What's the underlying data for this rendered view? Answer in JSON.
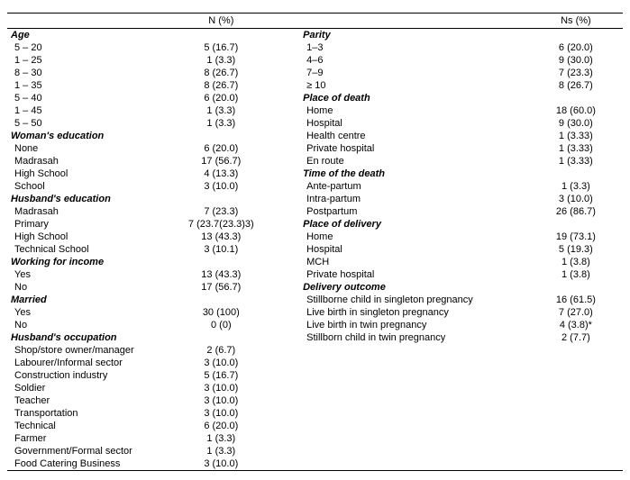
{
  "header": {
    "col1": "N (%)",
    "col2": "Ns (%)"
  },
  "left": [
    {
      "type": "section",
      "label": "Age"
    },
    {
      "type": "row",
      "label": "5 – 20",
      "value": "5 (16.7)"
    },
    {
      "type": "row",
      "label": "1 – 25",
      "value": "1 (3.3)"
    },
    {
      "type": "row",
      "label": "8 – 30",
      "value": "8 (26.7)"
    },
    {
      "type": "row",
      "label": "1 – 35",
      "value": "8 (26.7)"
    },
    {
      "type": "row",
      "label": "5 – 40",
      "value": "6 (20.0)"
    },
    {
      "type": "row",
      "label": "1 – 45",
      "value": "1 (3.3)"
    },
    {
      "type": "row",
      "label": "5 – 50",
      "value": "1 (3.3)"
    },
    {
      "type": "section",
      "label": "Woman's education"
    },
    {
      "type": "row",
      "label": "None",
      "value": "6 (20.0)"
    },
    {
      "type": "row",
      "label": "Madrasah",
      "value": "17 (56.7)"
    },
    {
      "type": "row",
      "label": "High School",
      "value": "4 (13.3)"
    },
    {
      "type": "row",
      "label": "School",
      "value": "3 (10.0)"
    },
    {
      "type": "section",
      "label": "Husband's education"
    },
    {
      "type": "row",
      "label": "Madrasah",
      "value": "7 (23.3)"
    },
    {
      "type": "row",
      "label": "Primary",
      "value": "7 (23.7(23.3)3)"
    },
    {
      "type": "row",
      "label": "High School",
      "value": "13 (43.3)"
    },
    {
      "type": "row",
      "label": "Technical School",
      "value": "3 (10.1)"
    },
    {
      "type": "section",
      "label": "Working for income"
    },
    {
      "type": "row",
      "label": "Yes",
      "value": "13 (43.3)"
    },
    {
      "type": "row",
      "label": "No",
      "value": "17 (56.7)"
    },
    {
      "type": "section",
      "label": "Married"
    },
    {
      "type": "row",
      "label": "Yes",
      "value": "30 (100)"
    },
    {
      "type": "row",
      "label": "No",
      "value": "0 (0)"
    },
    {
      "type": "section",
      "label": "Husband's occupation"
    },
    {
      "type": "row",
      "label": "Shop/store owner/manager",
      "value": "2 (6.7)"
    },
    {
      "type": "row",
      "label": "Labourer/Informal sector",
      "value": "3 (10.0)"
    },
    {
      "type": "row",
      "label": "Construction industry",
      "value": "5 (16.7)"
    },
    {
      "type": "row",
      "label": "Soldier",
      "value": "3 (10.0)"
    },
    {
      "type": "row",
      "label": "Teacher",
      "value": "3 (10.0)"
    },
    {
      "type": "row",
      "label": "Transportation",
      "value": "3 (10.0)"
    },
    {
      "type": "row",
      "label": "Technical",
      "value": "6 (20.0)"
    },
    {
      "type": "row",
      "label": "Farmer",
      "value": "1 (3.3)"
    },
    {
      "type": "row",
      "label": "Government/Formal sector",
      "value": "1 (3.3)"
    },
    {
      "type": "row",
      "label": "Food Catering Business",
      "value": "3 (10.0)"
    }
  ],
  "right": [
    {
      "type": "section",
      "label": "Parity"
    },
    {
      "type": "row",
      "label": "1–3",
      "value": "6 (20.0)"
    },
    {
      "type": "row",
      "label": "4–6",
      "value": "9 (30.0)"
    },
    {
      "type": "row",
      "label": "7–9",
      "value": "7 (23.3)"
    },
    {
      "type": "row",
      "label": "≥ 10",
      "value": "8 (26.7)"
    },
    {
      "type": "section",
      "label": "Place of death"
    },
    {
      "type": "row",
      "label": "Home",
      "value": "18 (60.0)"
    },
    {
      "type": "row",
      "label": "Hospital",
      "value": "9 (30.0)"
    },
    {
      "type": "row",
      "label": "Health centre",
      "value": "1 (3.33)"
    },
    {
      "type": "row",
      "label": "Private hospital",
      "value": "1 (3.33)"
    },
    {
      "type": "row",
      "label": "En route",
      "value": "1 (3.33)"
    },
    {
      "type": "section",
      "label": "Time of the death"
    },
    {
      "type": "row",
      "label": "Ante-partum",
      "value": "1 (3.3)"
    },
    {
      "type": "row",
      "label": "Intra-partum",
      "value": "3 (10.0)"
    },
    {
      "type": "row",
      "label": "Postpartum",
      "value": "26 (86.7)"
    },
    {
      "type": "section",
      "label": "Place of delivery"
    },
    {
      "type": "row",
      "label": "Home",
      "value": "19 (73.1)"
    },
    {
      "type": "row",
      "label": "Hospital",
      "value": "5 (19.3)"
    },
    {
      "type": "row",
      "label": "MCH",
      "value": "1 (3.8)"
    },
    {
      "type": "row",
      "label": "Private hospital",
      "value": "1 (3.8)"
    },
    {
      "type": "section",
      "label": "Delivery outcome"
    },
    {
      "type": "row",
      "label": "Stillborne child in singleton pregnancy",
      "value": "16 (61.5)"
    },
    {
      "type": "row",
      "label": "Live birth in singleton pregnancy",
      "value": "7 (27.0)"
    },
    {
      "type": "row",
      "label": "Live birth in twin pregnancy",
      "value": "4 (3.8)*"
    },
    {
      "type": "row",
      "label": "Stillborn child in twin pregnancy",
      "value": "2 (7.7)"
    }
  ]
}
